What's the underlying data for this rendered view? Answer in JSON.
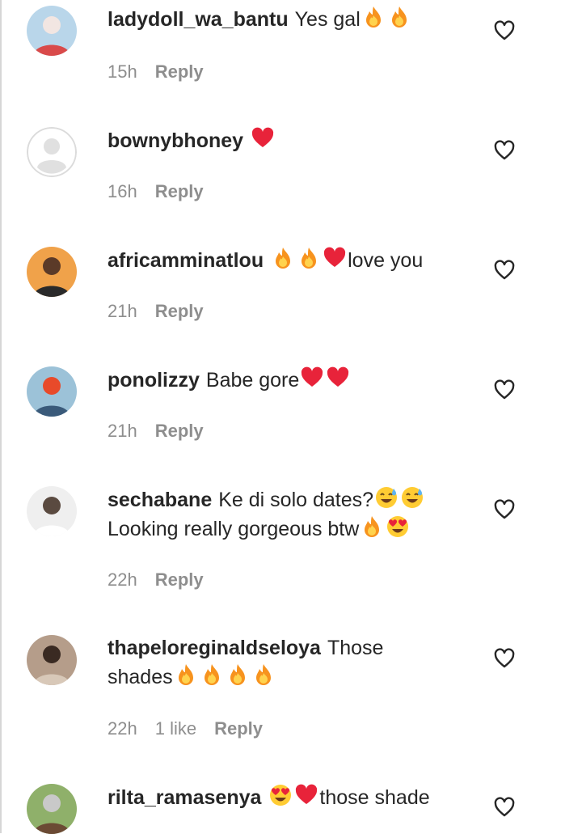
{
  "comments": [
    {
      "username": "ladydoll_wa_bantu",
      "text": "Yes gal",
      "emojis": [
        "fire",
        "fire"
      ],
      "text_after": "",
      "text2": "",
      "emojis2": [],
      "time": "15h",
      "likes": "",
      "reply_label": "Reply",
      "avatar_palette": [
        "#b9d6ea",
        "#f2e6e2",
        "#d94a4a"
      ]
    },
    {
      "username": "bownybhoney",
      "text": "",
      "emojis": [
        "heart"
      ],
      "text_after": "",
      "text2": "",
      "emojis2": [],
      "time": "16h",
      "likes": "",
      "reply_label": "Reply",
      "avatar_palette": [
        "#e9e9e9",
        "#ffffff",
        "#e9e9e9"
      ]
    },
    {
      "username": "africamminatlou",
      "text": "",
      "emojis": [
        "fire",
        "fire",
        "heart"
      ],
      "text_after": "love you",
      "text2": "",
      "emojis2": [],
      "time": "21h",
      "likes": "",
      "reply_label": "Reply",
      "avatar_palette": [
        "#f0a24a",
        "#5b3a28",
        "#2a2a2a"
      ]
    },
    {
      "username": "ponolizzy",
      "text": "Babe gore",
      "emojis": [
        "heart",
        "heart"
      ],
      "text_after": "",
      "text2": "",
      "emojis2": [],
      "time": "21h",
      "likes": "",
      "reply_label": "Reply",
      "avatar_palette": [
        "#9cc2d8",
        "#e84a2a",
        "#3a5a7a"
      ]
    },
    {
      "username": "sechabane",
      "text": "Ke di solo dates?",
      "emojis": [
        "sweat-smile",
        "sweat-smile"
      ],
      "text_after": "",
      "text2": "Looking really gorgeous btw",
      "emojis2": [
        "fire",
        "heart-eyes"
      ],
      "time": "22h",
      "likes": "",
      "reply_label": "Reply",
      "avatar_palette": [
        "#efefef",
        "#5a4a40",
        "#ffffff"
      ]
    },
    {
      "username": "thapeloreginaldseloya",
      "text": "Those",
      "emojis": [],
      "text_after": "",
      "text2": "shades",
      "emojis2": [
        "fire",
        "fire",
        "fire",
        "fire"
      ],
      "time": "22h",
      "likes": "1 like",
      "reply_label": "Reply",
      "avatar_palette": [
        "#b59d8a",
        "#3a2a22",
        "#d8c8b8"
      ]
    },
    {
      "username": "rilta_ramasenya",
      "text": "",
      "emojis": [
        "heart-eyes",
        "heart"
      ],
      "text_after": "those shade",
      "text2": "",
      "emojis2": [],
      "time": "",
      "likes": "",
      "reply_label": "",
      "avatar_palette": [
        "#8fb06a",
        "#c9c9c9",
        "#6b4a34"
      ]
    }
  ],
  "icons": {
    "like": "heart-outline-icon",
    "fire": "fire-emoji",
    "heart": "red-heart-emoji",
    "sweat-smile": "grinning-face-with-sweat-emoji",
    "heart-eyes": "smiling-face-with-heart-eyes-emoji",
    "avatar_placeholder": "default-avatar-icon"
  },
  "colors": {
    "text": "#262626",
    "meta": "#8e8e8e",
    "emoji_red": "#e8233a",
    "fire_orange": "#f7931e",
    "emoji_yellow": "#ffcc33"
  }
}
